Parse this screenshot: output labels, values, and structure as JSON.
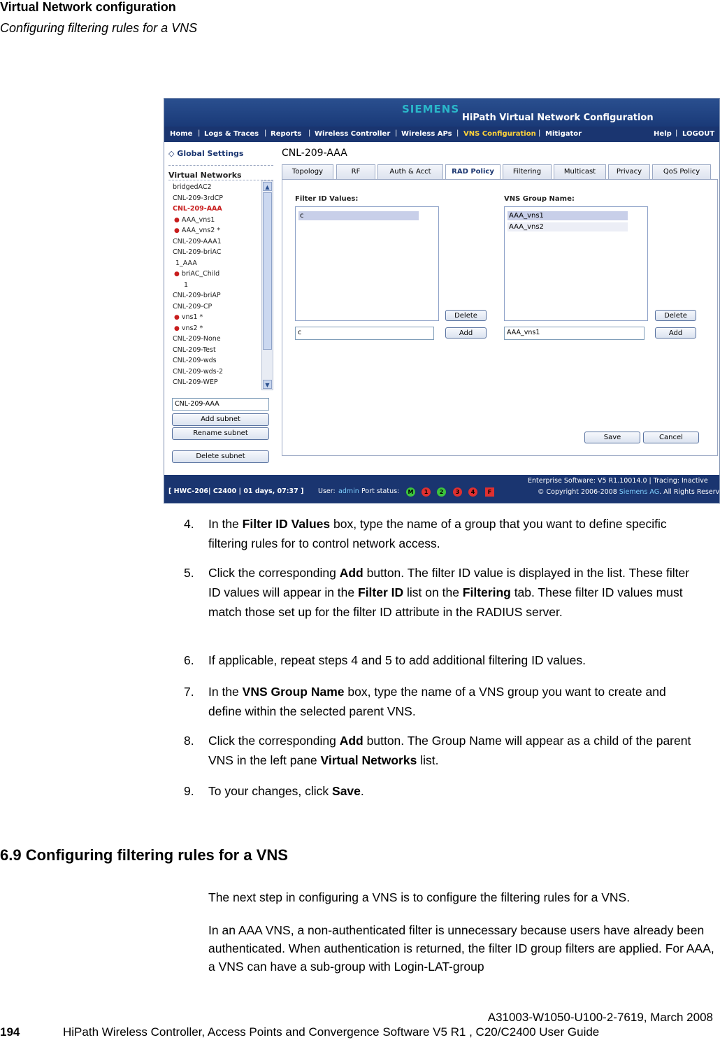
{
  "header": {
    "chapter": "Virtual Network configuration",
    "subtitle": "Configuring filtering rules for a VNS"
  },
  "screenshot": {
    "brand": "SIEMENS",
    "app_title": "HiPath Virtual Network Configuration",
    "nav": {
      "home": "Home",
      "logs": "Logs & Traces",
      "reports": "Reports",
      "wireless_controller": "Wireless Controller",
      "wireless_aps": "Wireless APs",
      "vns_configuration": "VNS Configuration",
      "mitigator": "Mitigator",
      "help": "Help",
      "logout": "LOGOUT",
      "sep": "|"
    },
    "left": {
      "global_settings": "◇  Global Settings",
      "virtual_networks_heading": "Virtual Networks",
      "items": {
        "i0": "bridgedAC2",
        "i1": "CNL-209-3rdCP",
        "i2": "CNL-209-AAA",
        "i3": "AAA_vns1",
        "i4": "AAA_vns2 *",
        "i5": "CNL-209-AAA1",
        "i6": "CNL-209-briAC",
        "i7": "1_AAA",
        "i8": "briAC_Child",
        "i9": "1",
        "i10": "CNL-209-briAP",
        "i11": "CNL-209-CP",
        "i12": "vns1 *",
        "i13": "vns2 *",
        "i14": "CNL-209-None",
        "i15": "CNL-209-Test",
        "i16": "CNL-209-wds",
        "i17": "CNL-209-wds-2",
        "i18": "CNL-209-WEP"
      },
      "bullet": "●",
      "scroll_up": "▲",
      "scroll_down": "▼",
      "subnet_input_value": "CNL-209-AAA",
      "add_subnet": "Add subnet",
      "rename_subnet": "Rename subnet",
      "delete_subnet": "Delete subnet"
    },
    "main": {
      "vns_name": "CNL-209-AAA",
      "tabs": {
        "topology": "Topology",
        "rf": "RF",
        "auth": "Auth & Acct",
        "rad_policy": "RAD Policy",
        "filtering": "Filtering",
        "multicast": "Multicast",
        "privacy": "Privacy",
        "qos": "QoS Policy"
      },
      "filter_label": "Filter ID Values:",
      "filter_list": {
        "r0": "c"
      },
      "filter_input_value": "c",
      "vns_group_label": "VNS Group Name:",
      "group_list": {
        "r0": "AAA_vns1",
        "r1": "AAA_vns2"
      },
      "group_input_value": "AAA_vns1",
      "delete": "Delete",
      "add": "Add",
      "save": "Save",
      "cancel": "Cancel"
    },
    "status": {
      "left": "[ HWC-206| C2400 | 01 days, 07:37 ]",
      "user_label": "User:",
      "user": "admin",
      "port_label": "Port status:",
      "ports": {
        "m": "M",
        "p1": "1",
        "p2": "2",
        "p3": "3",
        "p4": "4",
        "f": "F"
      },
      "software": "Enterprise Software: V5 R1.10014.0 | Tracing: Inactive",
      "copyright_a": "© Copyright  2006-2008",
      "copyright_link": "Siemens AG",
      "copyright_b": ". All Rights Reserved."
    }
  },
  "steps": {
    "s4": {
      "num": "4.",
      "a": "In the ",
      "b": "Filter ID Values",
      "c": " box, type the name of a group that you want to define specific filtering rules for to control network access."
    },
    "s5": {
      "num": "5.",
      "a": "Click the corresponding ",
      "b": "Add",
      "c": " button. The filter ID value is displayed in the list. These filter ID values will appear in the ",
      "d": "Filter ID",
      "e": " list on the ",
      "f": "Filtering",
      "g": " tab. These filter ID values must match those set up for the filter ID attribute in the RADIUS server."
    },
    "s6": {
      "num": "6.",
      "a": "If applicable, repeat steps 4 and 5 to add additional filtering ID values."
    },
    "s7": {
      "num": "7.",
      "a": "In the ",
      "b": "VNS Group Name",
      "c": " box, type the name of a VNS group you want to create and define within the selected parent VNS."
    },
    "s8": {
      "num": "8.",
      "a": "Click the corresponding ",
      "b": "Add",
      "c": " button. The Group Name will appear as a child of the parent VNS in the left pane ",
      "d": "Virtual Networks",
      "e": " list."
    },
    "s9": {
      "num": "9.",
      "a": "To your changes, click ",
      "b": "Save",
      "c": "."
    }
  },
  "section": {
    "title": "6.9  Configuring filtering rules for a VNS",
    "p1": "The next step in configuring a VNS is to configure the filtering rules for a VNS.",
    "p2": "In an AAA VNS, a non-authenticated filter is unnecessary because users have already been authenticated. When authentication is returned, the filter ID group filters are applied. For AAA, a VNS can have a sub-group with Login-LAT-group"
  },
  "footer": {
    "doc_id": "A31003-W1050-U100-2-7619, March 2008",
    "page": "194",
    "guide": "HiPath Wireless Controller, Access Points and Convergence Software V5 R1 , C20/C2400 User Guide"
  },
  "colors": {
    "banner": "#1a3a78",
    "active_nav": "#ffd33a",
    "selected_vns": "#c81e1e",
    "port_m": "#3cc43c",
    "port_1": "#e03030",
    "port_2": "#3cc43c",
    "port_3": "#e03030",
    "port_4": "#e03030",
    "port_f": "#e03030"
  }
}
